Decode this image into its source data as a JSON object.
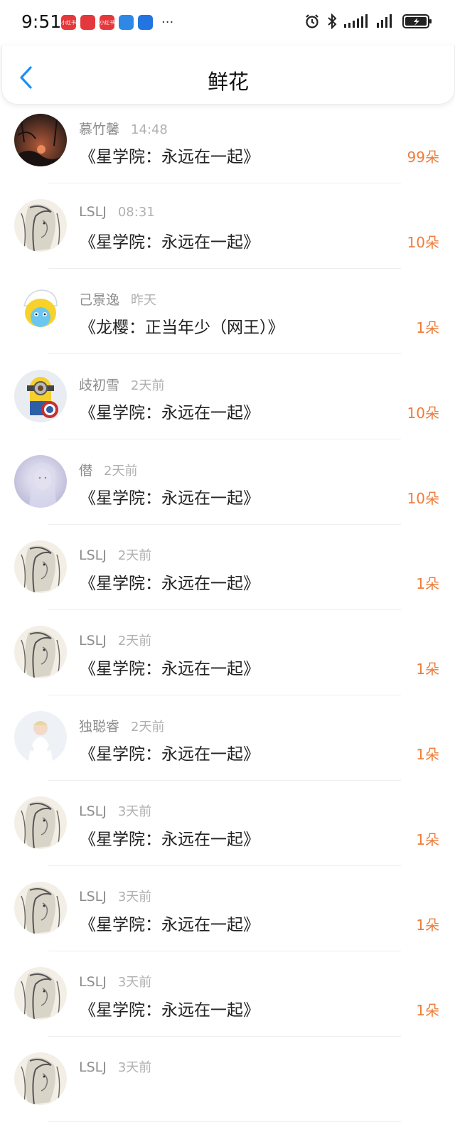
{
  "status": {
    "time": "9:51",
    "notifications": [
      {
        "name": "xiaohongshu-icon",
        "text": "小红书",
        "color": "#e4393c"
      },
      {
        "name": "book-app-icon",
        "text": "",
        "color": "#e4393c"
      },
      {
        "name": "xiaohongshu-icon-2",
        "text": "小红书",
        "color": "#e4393c"
      },
      {
        "name": "weather-icon",
        "text": "",
        "color": "#2f88e6"
      },
      {
        "name": "bulb-app-icon",
        "text": "",
        "color": "#2275e0"
      }
    ],
    "more": "···"
  },
  "header": {
    "title": "鲜花"
  },
  "items": [
    {
      "user": "慕竹馨",
      "time": "14:48",
      "book": "《星学院：永远在一起》",
      "count": "99朵",
      "avatar": "dark"
    },
    {
      "user": "LSLJ",
      "time": "08:31",
      "book": "《星学院：永远在一起》",
      "count": "10朵",
      "avatar": "sketch"
    },
    {
      "user": "己景逸",
      "time": "昨天",
      "book": "《龙樱：正当年少（网王）》",
      "count": "1朵",
      "avatar": "smurf"
    },
    {
      "user": "歧初雪",
      "time": "2天前",
      "book": "《星学院：永远在一起》",
      "count": "10朵",
      "avatar": "minion"
    },
    {
      "user": "僣",
      "time": "2天前",
      "book": "《星学院：永远在一起》",
      "count": "10朵",
      "avatar": "pale"
    },
    {
      "user": "LSLJ",
      "time": "2天前",
      "book": "《星学院：永远在一起》",
      "count": "1朵",
      "avatar": "sketch"
    },
    {
      "user": "LSLJ",
      "time": "2天前",
      "book": "《星学院：永远在一起》",
      "count": "1朵",
      "avatar": "sketch"
    },
    {
      "user": "独聪睿",
      "time": "2天前",
      "book": "《星学院：永远在一起》",
      "count": "1朵",
      "avatar": "child"
    },
    {
      "user": "LSLJ",
      "time": "3天前",
      "book": "《星学院：永远在一起》",
      "count": "1朵",
      "avatar": "sketch"
    },
    {
      "user": "LSLJ",
      "time": "3天前",
      "book": "《星学院：永远在一起》",
      "count": "1朵",
      "avatar": "sketch"
    },
    {
      "user": "LSLJ",
      "time": "3天前",
      "book": "《星学院：永远在一起》",
      "count": "1朵",
      "avatar": "sketch"
    },
    {
      "user": "LSLJ",
      "time": "3天前",
      "book": "",
      "count": "",
      "avatar": "sketch"
    }
  ],
  "colors": {
    "accent": "#1e8ff2",
    "count": "#ef7c3a"
  }
}
